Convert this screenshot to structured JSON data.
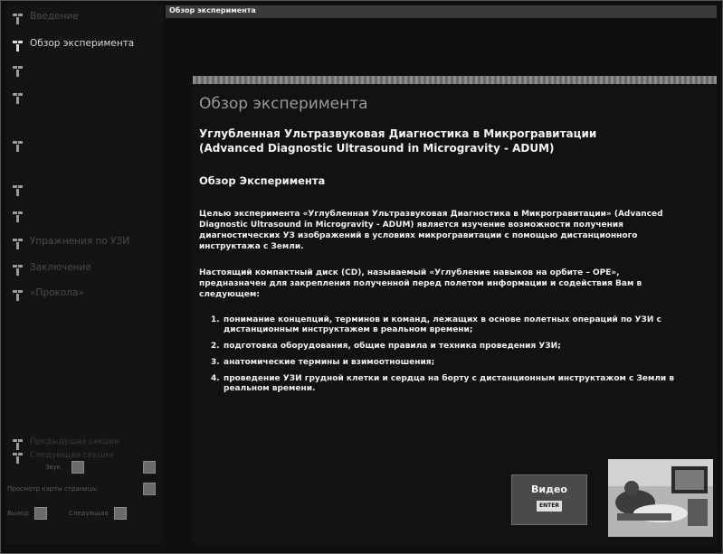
{
  "window": {
    "title": "Обзор эксперимента"
  },
  "sidebar": {
    "items": [
      {
        "label": "Введение",
        "state": "dim"
      },
      {
        "label": "Обзор эксперимента",
        "state": "active"
      },
      {
        "label": "",
        "state": "dim"
      },
      {
        "label": "",
        "state": "dim"
      },
      {
        "label": "",
        "state": "dim"
      },
      {
        "label": "",
        "state": "dim"
      },
      {
        "label": "",
        "state": "dim"
      },
      {
        "label": "Упражнения по УЗИ",
        "state": "dim"
      },
      {
        "label": "Заключение",
        "state": "dim"
      },
      {
        "label": "«Прокола»",
        "state": "dim"
      }
    ],
    "footer_items": [
      "Предыдущая секция",
      "Следующая секция"
    ],
    "controls": {
      "back": "Звук",
      "overview": "Просмотр карты страницы",
      "prev": "Выход",
      "next": "Следующая"
    }
  },
  "main": {
    "heading": "Обзор эксперимента",
    "subtitle_line1": "Углубленная Ультразвуковая Диагностика в Микрогравитации",
    "subtitle_line2": "(Advanced Diagnostic Ultrasound in Microgravity - ADUM)",
    "section_title": "Обзор Эксперимента",
    "paragraph1": "Целью эксперимента «Углубленная Ультразвуковая Диагностика в Микрогравитации» (Advanced Diagnostic Ultrasound in Microgravity - ADUM) является изучение возможности получения диагностических УЗ изображений в условиях микрогравитации с помощью дистанционного инструктажа с Земли.",
    "paragraph2": "Настоящий компактный диск (CD), называемый «Углубление навыков на орбите – OPE», предназначен для закрепления полученной перед полетом информации и содействия Вам в следующем:",
    "list": [
      {
        "n": "1.",
        "text": "понимание концепций, терминов и команд, лежащих в основе полетных операций по УЗИ с дистанционным инструктажем в реальном времени;"
      },
      {
        "n": "2.",
        "text": "подготовка оборудования, общие правила и техника проведения УЗИ;"
      },
      {
        "n": "3.",
        "text": "анатомические термины и взимоотношения;"
      },
      {
        "n": "4.",
        "text": "проведение УЗИ грудной клетки и сердца на борту с дистанционным инструктажом с Земли в реальном времени."
      }
    ]
  },
  "video": {
    "label": "Видео",
    "button": "ENTER"
  }
}
